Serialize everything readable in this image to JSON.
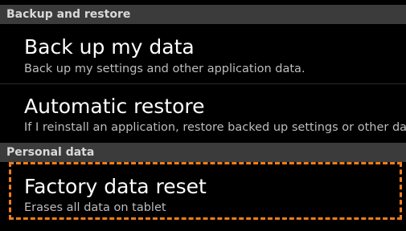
{
  "sections": [
    {
      "header": "Backup and restore",
      "items": [
        {
          "title": "Back up my data",
          "summary": "Back up my settings and other application data."
        },
        {
          "title": "Automatic restore",
          "summary": "If I reinstall an application, restore backed up settings or other data."
        }
      ]
    },
    {
      "header": "Personal data",
      "items": [
        {
          "title": "Factory data reset",
          "summary": "Erases all data on tablet"
        }
      ]
    }
  ],
  "colors": {
    "section_header_bg": "#3b3b3b",
    "highlight_annotation": "#f07d1a"
  }
}
